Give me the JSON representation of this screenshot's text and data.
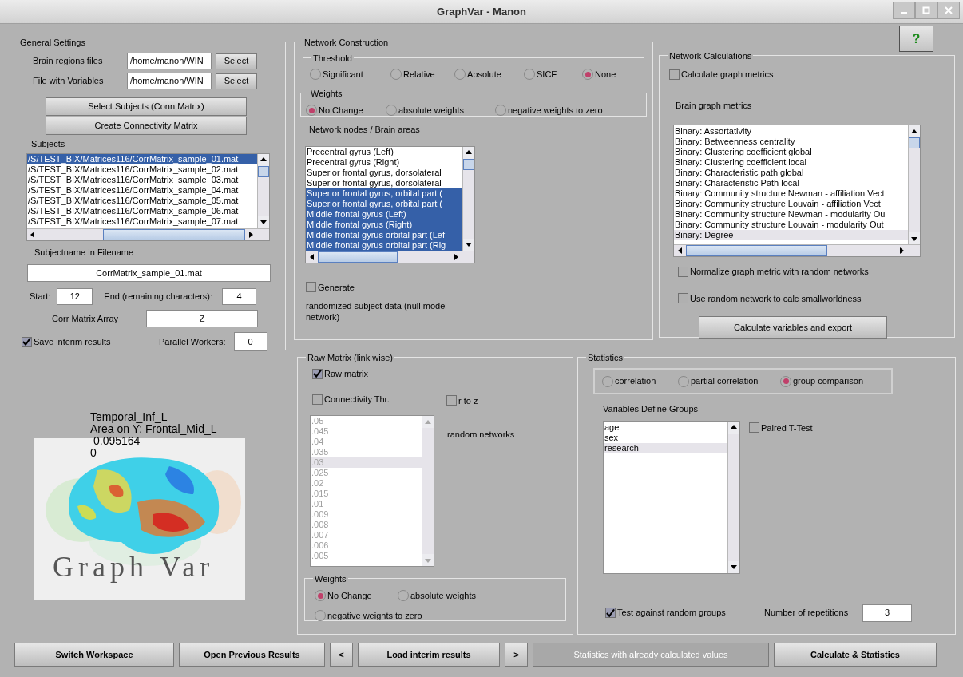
{
  "window": {
    "title": "GraphVar - Manon"
  },
  "help_button": "?",
  "general_settings": {
    "title": "General Settings",
    "file_rows": [
      {
        "label": "Brain regions files",
        "value": "/home/manon/WIN",
        "button": "Select"
      },
      {
        "label": "File with Variables",
        "value": "/home/manon/WIN",
        "button": "Select"
      }
    ],
    "select_subjects_button": "Select Subjects (Conn Matrix)",
    "create_matrix_button": "Create Connectivity Matrix",
    "subjects_label": "Subjects",
    "subjects": [
      {
        "text": "/S/TEST_BIX/Matrices116/CorrMatrix_sample_01.mat",
        "selected": true
      },
      {
        "text": "/S/TEST_BIX/Matrices116/CorrMatrix_sample_02.mat",
        "selected": false
      },
      {
        "text": "/S/TEST_BIX/Matrices116/CorrMatrix_sample_03.mat",
        "selected": false
      },
      {
        "text": "/S/TEST_BIX/Matrices116/CorrMatrix_sample_04.mat",
        "selected": false
      },
      {
        "text": "/S/TEST_BIX/Matrices116/CorrMatrix_sample_05.mat",
        "selected": false
      },
      {
        "text": "/S/TEST_BIX/Matrices116/CorrMatrix_sample_06.mat",
        "selected": false
      },
      {
        "text": "/S/TEST_BIX/Matrices116/CorrMatrix_sample_07.mat",
        "selected": false
      }
    ],
    "subjectname_label": "Subjectname in Filename",
    "subjectname_value": "CorrMatrix_sample_01.mat",
    "start_label": "Start:",
    "start_value": "12",
    "end_label": "End (remaining characters):",
    "end_value": "4",
    "corr_label": "Corr Matrix Array",
    "corr_value": "Z",
    "save_interim": {
      "label": "Save interim results",
      "checked": true
    },
    "workers_label": "Parallel Workers:",
    "workers_value": "0"
  },
  "network_construction": {
    "title": "Network Construction",
    "threshold": {
      "title": "Threshold",
      "options": [
        {
          "label": "Significant",
          "selected": false
        },
        {
          "label": "Relative",
          "selected": false
        },
        {
          "label": "Absolute",
          "selected": false
        },
        {
          "label": "SICE",
          "selected": false
        },
        {
          "label": "None",
          "selected": true
        }
      ]
    },
    "weights": {
      "title": "Weights",
      "options": [
        {
          "label": "No Change",
          "selected": true
        },
        {
          "label": "absolute weights",
          "selected": false
        },
        {
          "label": "negative weights to zero",
          "selected": false
        }
      ]
    },
    "nodes_label": "Network nodes / Brain areas",
    "nodes": [
      {
        "text": "Precentral gyrus (Left)",
        "selected": false
      },
      {
        "text": "Precentral gyrus (Right)",
        "selected": false
      },
      {
        "text": "Superior frontal gyrus, dorsolateral",
        "selected": false
      },
      {
        "text": "Superior frontal gyrus, dorsolateral",
        "selected": false
      },
      {
        "text": "Superior frontal gyrus, orbital part (",
        "selected": true
      },
      {
        "text": "Superior frontal gyrus, orbital part (",
        "selected": true
      },
      {
        "text": "Middle frontal gyrus (Left)",
        "selected": true
      },
      {
        "text": "Middle frontal gyrus (Right)",
        "selected": true
      },
      {
        "text": "Middle frontal gyrus orbital part (Lef",
        "selected": true
      },
      {
        "text": "Middle frontal gyrus orbital part (Rig",
        "selected": true
      }
    ],
    "generate": {
      "label": "Generate",
      "checked": false
    },
    "generate_note": "randomized subject data (null model network)"
  },
  "network_calculations": {
    "title": "Network Calculations",
    "calculate_metrics": {
      "label": "Calculate graph metrics",
      "checked": false
    },
    "metrics_label": "Brain graph metrics",
    "metrics": [
      {
        "text": "Binary: Assortativity",
        "highlighted": false
      },
      {
        "text": "Binary: Betweenness centrality",
        "highlighted": false
      },
      {
        "text": "Binary: Clustering coefficient global",
        "highlighted": false
      },
      {
        "text": "Binary: Clustering coefficient local",
        "highlighted": false
      },
      {
        "text": "Binary: Characteristic path global",
        "highlighted": false
      },
      {
        "text": "Binary: Characteristic Path local",
        "highlighted": false
      },
      {
        "text": "Binary: Community structure Newman - affiliation Vect",
        "highlighted": false
      },
      {
        "text": "Binary: Community structure Louvain - affiliation Vect",
        "highlighted": false
      },
      {
        "text": "Binary: Community structure Newman - modularity Ou",
        "highlighted": false
      },
      {
        "text": "Binary: Community structure Louvain - modularity Out",
        "highlighted": false
      },
      {
        "text": "Binary: Degree",
        "highlighted": true
      }
    ],
    "normalize": {
      "label": "Normalize graph metric with random networks",
      "checked": false
    },
    "smallworld": {
      "label": "Use random network to calc smallworldness",
      "checked": false
    },
    "export_button": "Calculate variables and export"
  },
  "preview": {
    "area_x": "Temporal_Inf_L",
    "area_y": "Area on Y: Frontal_Mid_L",
    "value": "0.095164",
    "value_2": "0",
    "logo_text": "Graph Var"
  },
  "raw_matrix": {
    "title": "Raw Matrix (link wise)",
    "raw": {
      "label": "Raw matrix",
      "checked": true
    },
    "connectivity": {
      "label": "Connectivity Thr.",
      "checked": false
    },
    "r_to_z": {
      "label": "r to z",
      "checked": false
    },
    "thresholds_disabled": true,
    "thresholds": [
      {
        "text": ".05",
        "highlighted": false
      },
      {
        "text": ".045",
        "highlighted": false
      },
      {
        "text": ".04",
        "highlighted": false
      },
      {
        "text": ".035",
        "highlighted": false
      },
      {
        "text": ".03",
        "highlighted": true
      },
      {
        "text": ".025",
        "highlighted": false
      },
      {
        "text": ".02",
        "highlighted": false
      },
      {
        "text": ".015",
        "highlighted": false
      },
      {
        "text": ".01",
        "highlighted": false
      },
      {
        "text": ".009",
        "highlighted": false
      },
      {
        "text": ".008",
        "highlighted": false
      },
      {
        "text": ".007",
        "highlighted": false
      },
      {
        "text": ".006",
        "highlighted": false
      },
      {
        "text": ".005",
        "highlighted": false
      }
    ],
    "random_label": "random networks",
    "weights": {
      "title": "Weights",
      "options": [
        {
          "label": "No Change",
          "selected": true
        },
        {
          "label": "absolute weights",
          "selected": false
        },
        {
          "label": "negative weights to zero",
          "selected": false
        }
      ]
    }
  },
  "statistics": {
    "title": "Statistics",
    "modes": [
      {
        "label": "correlation",
        "selected": false
      },
      {
        "label": "partial correlation",
        "selected": false
      },
      {
        "label": "group comparison",
        "selected": true
      }
    ],
    "groups_label": "Variables Define Groups",
    "variables": [
      {
        "text": "age",
        "highlighted": false
      },
      {
        "text": "sex",
        "highlighted": false
      },
      {
        "text": "research",
        "highlighted": true
      }
    ],
    "paired": {
      "label": "Paired T-Test",
      "checked": false
    },
    "random_groups": {
      "label": "Test against random groups",
      "checked": true
    },
    "repetitions_label": "Number of repetitions",
    "repetitions_value": "3"
  },
  "bottom_buttons": [
    {
      "label": "Switch Workspace",
      "disabled": false
    },
    {
      "label": "Open Previous Results",
      "disabled": false
    },
    {
      "label": "<",
      "disabled": false
    },
    {
      "label": "Load interim results",
      "disabled": false
    },
    {
      "label": ">",
      "disabled": false
    },
    {
      "label": "Statistics with already calculated values",
      "disabled": true
    },
    {
      "label": "Calculate & Statistics",
      "disabled": false
    }
  ]
}
